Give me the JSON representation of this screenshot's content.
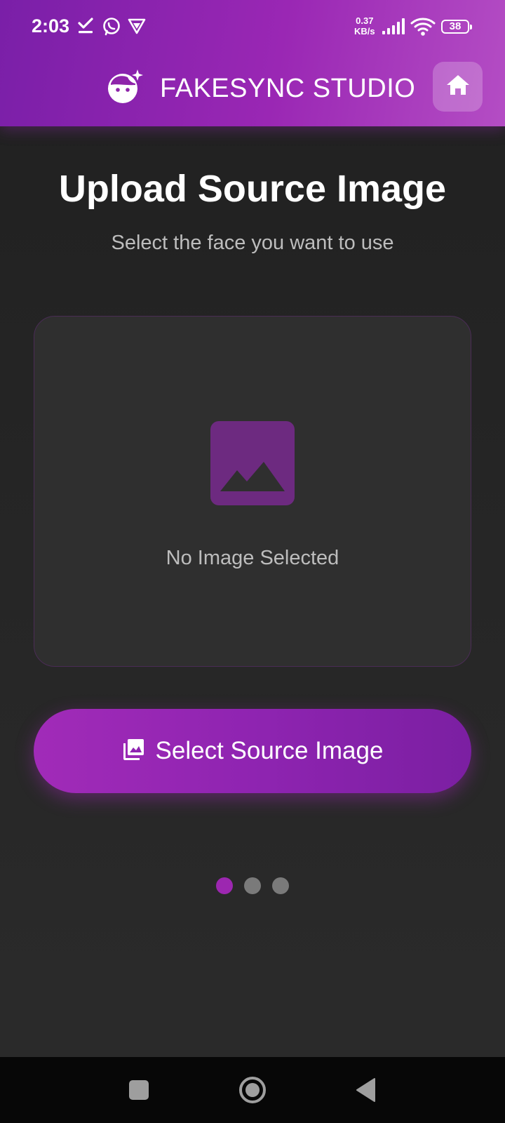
{
  "status_bar": {
    "time": "2:03",
    "net_speed_value": "0.37",
    "net_speed_unit": "KB/s",
    "battery": "38",
    "icons": [
      "download-done-icon",
      "whatsapp-icon",
      "vpn-shield-icon",
      "signal-icon",
      "wifi-icon",
      "battery-icon"
    ]
  },
  "app_bar": {
    "title": "FAKESYNC STUDIO",
    "logo_icon": "face-retouching-icon",
    "home_icon": "home-icon"
  },
  "main": {
    "title": "Upload Source Image",
    "subtitle": "Select the face you want to use",
    "preview": {
      "placeholder_icon": "image-icon",
      "empty_text": "No Image Selected"
    },
    "select_button": {
      "icon": "photo-library-icon",
      "label": "Select Source Image"
    },
    "pager": {
      "total": 3,
      "active_index": 0
    }
  },
  "nav_bar": {
    "buttons": [
      "recents-square-icon",
      "home-circle-icon",
      "back-triangle-icon"
    ]
  },
  "colors": {
    "accent": "#9c27b0",
    "header_start": "#7a1fa8",
    "header_end": "#b44dc4",
    "background": "#242424",
    "card": "#2f2f2f",
    "placeholder_icon": "#6d2a80",
    "muted_text": "#bdbdbd"
  }
}
